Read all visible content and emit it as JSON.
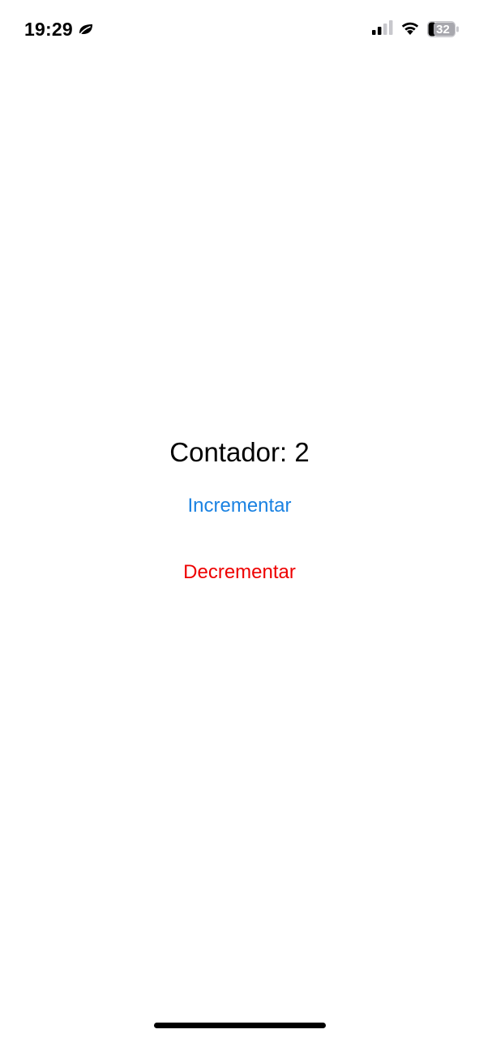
{
  "status_bar": {
    "time": "19:29",
    "focus_icon": "leaf-icon",
    "signal_icon": "cellular-signal-icon",
    "wifi_icon": "wifi-icon",
    "battery_icon": "battery-icon",
    "battery_level": "32"
  },
  "main": {
    "counter_text": "Contador: 2",
    "increment_label": "Incrementar",
    "decrement_label": "Decrementar"
  },
  "colors": {
    "increment": "#1a82e2",
    "decrement": "#ee0000",
    "text": "#000000",
    "background": "#ffffff"
  }
}
